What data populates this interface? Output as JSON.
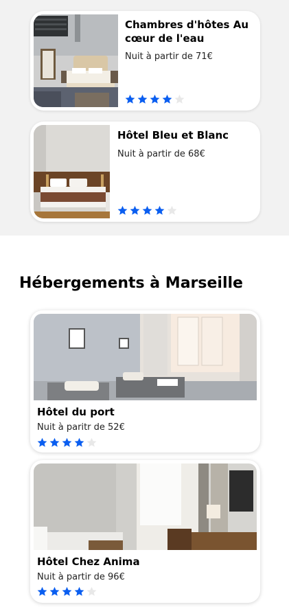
{
  "featured": [
    {
      "title": "Chambres d'hôtes Au cœur de l'eau",
      "price": "Nuit à partir de 71€",
      "rating": 4,
      "rating_max": 5
    },
    {
      "title": "Hôtel Bleu et Blanc",
      "price": "Nuit à partir de 68€",
      "rating": 4,
      "rating_max": 5
    }
  ],
  "section_title": "Hébergements à Marseille",
  "listings": [
    {
      "title": "Hôtel du port",
      "price": "Nuit à paritr de 52€",
      "rating": 4,
      "rating_max": 5
    },
    {
      "title": "Hôtel Chez Anima",
      "price": "Nuit à partir de 96€",
      "rating": 4,
      "rating_max": 5
    }
  ],
  "colors": {
    "star_filled": "#0a5ef0",
    "star_empty": "#e8e8e8",
    "grey_background": "#f2f2f2"
  }
}
